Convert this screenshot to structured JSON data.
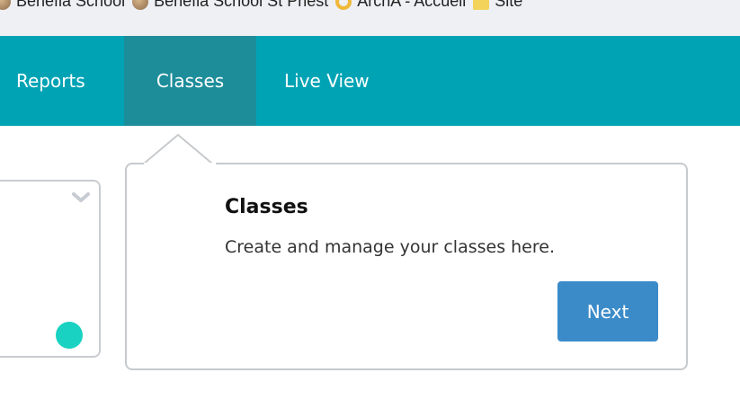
{
  "bookmarks": {
    "items": [
      {
        "label": "Benefia School",
        "icon": "school-globe-icon"
      },
      {
        "label": "Benefia School St Priest",
        "icon": "school-globe-icon"
      },
      {
        "label": "ArchA - Accueil",
        "icon": "ring-icon"
      },
      {
        "label": "Site",
        "icon": "folder-icon"
      }
    ]
  },
  "nav": {
    "items": [
      {
        "label": "Reports",
        "active": false
      },
      {
        "label": "Classes",
        "active": true
      },
      {
        "label": "Live View",
        "active": false
      }
    ],
    "colors": {
      "bar": "#00a3b4",
      "active": "#1d8d9a"
    }
  },
  "popover": {
    "title": "Classes",
    "text": "Create and manage your classes here.",
    "next_label": "Next"
  },
  "left_card": {
    "status_dot_color": "#19d2c1"
  }
}
